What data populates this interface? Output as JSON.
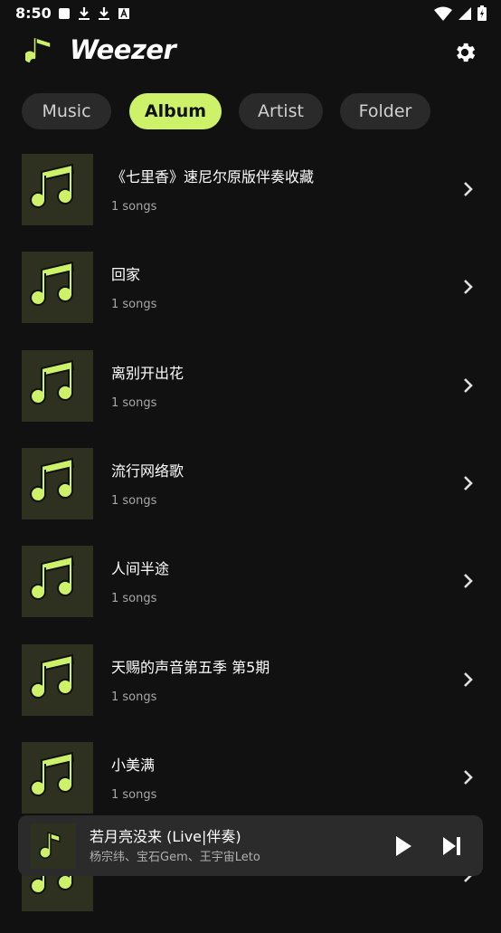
{
  "status_bar": {
    "time": "8:50",
    "left_icons": [
      "stop-square-icon",
      "download-icon",
      "download-icon",
      "text-a-icon"
    ],
    "right_icons": [
      "wifi-icon",
      "signal-icon",
      "battery-icon"
    ]
  },
  "header": {
    "app_name": "Weezer",
    "logo_icon": "music-note-icon",
    "settings_icon": "gear-icon"
  },
  "tabs": [
    {
      "label": "Music",
      "active": false
    },
    {
      "label": "Album",
      "active": true
    },
    {
      "label": "Artist",
      "active": false
    },
    {
      "label": "Folder",
      "active": false
    }
  ],
  "albums": [
    {
      "title": "《七里香》速尼尔原版伴奏收藏",
      "count": "1 songs"
    },
    {
      "title": "回家",
      "count": "1 songs"
    },
    {
      "title": "离别开出花",
      "count": "1 songs"
    },
    {
      "title": "流行网络歌",
      "count": "1 songs"
    },
    {
      "title": "人间半途",
      "count": "1 songs"
    },
    {
      "title": "天赐的声音第五季 第5期",
      "count": "1 songs"
    },
    {
      "title": "小美满",
      "count": "1 songs"
    },
    {
      "title": "",
      "count": ""
    }
  ],
  "player": {
    "title": "若月亮没来 (Live|伴奏)",
    "artist": "杨宗纬、宝石Gem、王宇宙Leto",
    "play_icon": "play-icon",
    "next_icon": "skip-next-icon"
  },
  "colors": {
    "accent": "#cdf26a",
    "background": "#111111",
    "tab_inactive": "#2a2a2a",
    "cover_bg": "#2e3120",
    "player_bg": "#2b2b2b"
  }
}
